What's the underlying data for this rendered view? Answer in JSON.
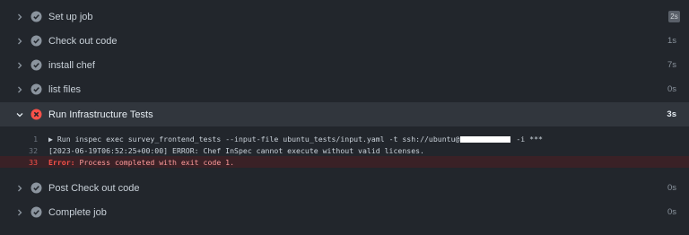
{
  "steps_top": [
    {
      "name": "Set up job",
      "duration": "2s",
      "status": "success"
    },
    {
      "name": "Check out code",
      "duration": "1s",
      "status": "success"
    },
    {
      "name": "install chef",
      "duration": "7s",
      "status": "success"
    },
    {
      "name": "list files",
      "duration": "0s",
      "status": "success"
    }
  ],
  "expanded_step": {
    "name": "Run Infrastructure Tests",
    "duration": "3s",
    "status": "failure"
  },
  "log": {
    "line1": {
      "number": "1",
      "arrow": "▶",
      "prefix": "Run inspec exec survey_frontend_tests --input-file ubuntu_tests/input.yaml -t ssh://ubuntu@",
      "suffix": " -i ***"
    },
    "line2": {
      "number": "32",
      "text": "[2023-06-19T06:52:25+00:00] ERROR: Chef InSpec cannot execute without valid licenses."
    },
    "line3": {
      "number": "33",
      "label": "Error:",
      "text": " Process completed with exit code 1."
    }
  },
  "steps_bottom": [
    {
      "name": "Post Check out code",
      "duration": "0s",
      "status": "success"
    },
    {
      "name": "Complete job",
      "duration": "0s",
      "status": "success"
    }
  ],
  "colors": {
    "success": "#8b949e",
    "failure": "#f85149",
    "background": "#22262c",
    "expanded": "#31363d"
  }
}
